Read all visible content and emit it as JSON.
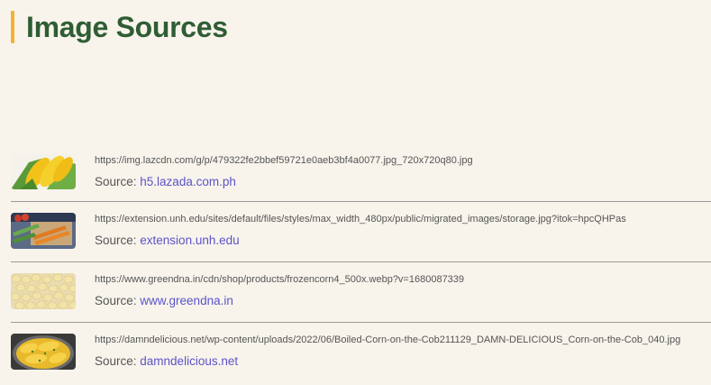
{
  "page": {
    "title": "Image Sources"
  },
  "sources": [
    {
      "url": "https://img.lazcdn.com/g/p/479322fe2bbef59721e0aeb3bf4a0077.jpg_720x720q80.jpg",
      "source_prefix": "Source: ",
      "domain": "h5.lazada.com.ph",
      "thumb_icon": "corn-cobs-thumbnail"
    },
    {
      "url": "https://extension.unh.edu/sites/default/files/styles/max_width_480px/public/migrated_images/storage.jpg?itok=hpcQHPas",
      "source_prefix": "Source: ",
      "domain": "extension.unh.edu",
      "thumb_icon": "vegetable-storage-thumbnail"
    },
    {
      "url": "https://www.greendna.in/cdn/shop/products/frozencorn4_500x.webp?v=1680087339",
      "source_prefix": "Source: ",
      "domain": "www.greendna.in",
      "thumb_icon": "corn-kernels-thumbnail"
    },
    {
      "url": "https://damndelicious.net/wp-content/uploads/2022/06/Boiled-Corn-on-the-Cob211129_DAMN-DELICIOUS_Corn-on-the-Cob_040.jpg",
      "source_prefix": "Source: ",
      "domain": "damndelicious.net",
      "thumb_icon": "boiled-corn-thumbnail"
    }
  ],
  "colors": {
    "title": "#2f5d34",
    "accent_bar": "#f2b233",
    "link": "#5b53c8",
    "background": "#f8f4ec"
  }
}
